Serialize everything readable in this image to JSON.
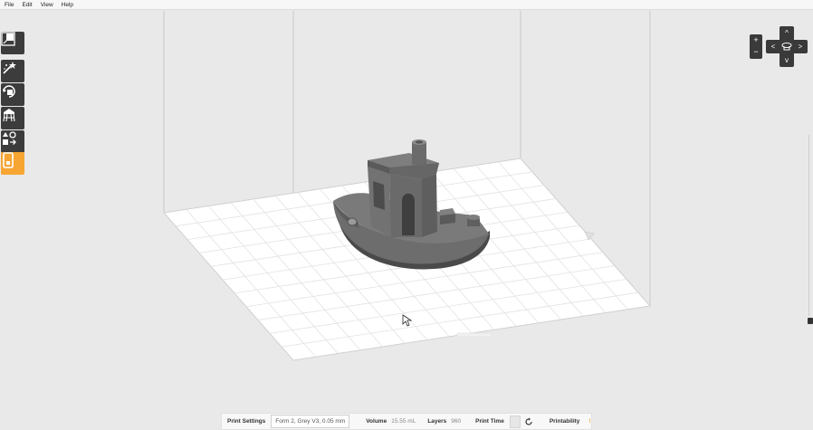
{
  "menu": [
    "File",
    "Edit",
    "View",
    "Help"
  ],
  "toolbar": {
    "tools": [
      {
        "name": "fit-view-tool",
        "icon": "fit-view-icon"
      },
      {
        "name": "magic-wand-tool",
        "icon": "magic-wand-icon"
      },
      {
        "name": "orient-tool",
        "icon": "orient-icon"
      },
      {
        "name": "supports-tool",
        "icon": "supports-icon"
      },
      {
        "name": "layout-tool",
        "icon": "layout-icon"
      },
      {
        "name": "job-tool",
        "icon": "job-icon"
      }
    ],
    "active_color": "#f7a533",
    "bg_color": "#3c3c3c"
  },
  "zoom": {
    "in": "+",
    "out": "−"
  },
  "camera": {
    "up": "^",
    "down": "v",
    "left": "<",
    "right": ">"
  },
  "status": {
    "print_settings_label": "Print Settings",
    "print_settings_value": "Form 2, Grey V3, 0.05 mm",
    "volume_label": "Volume",
    "volume_value": "15.55 mL",
    "layers_label": "Layers",
    "layers_value": "960",
    "print_time_label": "Print Time",
    "printability_label": "Printability",
    "printability_icon": "!"
  }
}
